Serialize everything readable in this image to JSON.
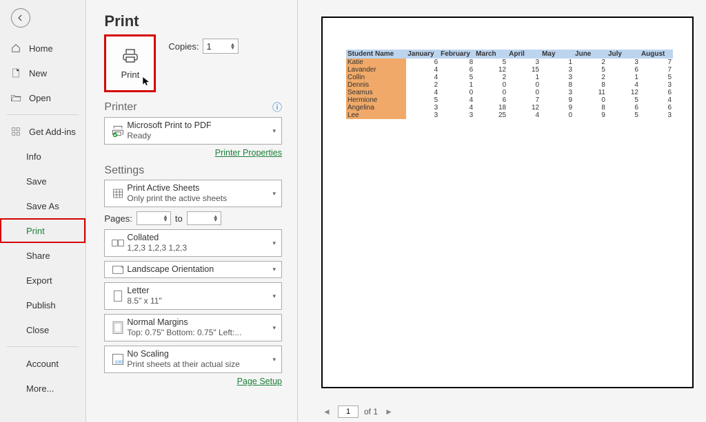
{
  "title": "Print",
  "sidebar": {
    "main": [
      "Home",
      "New",
      "Open"
    ],
    "addins": "Get Add-ins",
    "sub": [
      "Info",
      "Save",
      "Save As",
      "Print",
      "Share",
      "Export",
      "Publish",
      "Close"
    ],
    "bottom": [
      "Account",
      "More..."
    ],
    "active": "Print"
  },
  "print": {
    "btn_label": "Print",
    "copies_label": "Copies:",
    "copies_value": "1"
  },
  "printer": {
    "header": "Printer",
    "name": "Microsoft Print to PDF",
    "status": "Ready",
    "props_link": "Printer Properties"
  },
  "settings": {
    "header": "Settings",
    "active_sheets_t1": "Print Active Sheets",
    "active_sheets_t2": "Only print the active sheets",
    "pages_label": "Pages:",
    "pages_to": "to",
    "collated_t1": "Collated",
    "collated_t2": "1,2,3    1,2,3    1,2,3",
    "orientation": "Landscape Orientation",
    "paper_t1": "Letter",
    "paper_t2": "8.5\" x 11\"",
    "margins_t1": "Normal Margins",
    "margins_t2": "Top: 0.75\" Bottom: 0.75\" Left:...",
    "scaling_t1": "No Scaling",
    "scaling_t2": "Print sheets at their actual size",
    "setup_link": "Page Setup"
  },
  "pagenav": {
    "page": "1",
    "of_label": "of 1"
  },
  "chart_data": {
    "type": "table",
    "columns": [
      "Student Name",
      "January",
      "February",
      "March",
      "April",
      "May",
      "June",
      "July",
      "August"
    ],
    "rows": [
      [
        "Katie",
        6,
        8,
        5,
        3,
        1,
        2,
        3,
        7
      ],
      [
        "Lavander",
        4,
        6,
        12,
        15,
        3,
        5,
        6,
        7
      ],
      [
        "Collin",
        4,
        5,
        2,
        1,
        3,
        2,
        1,
        5
      ],
      [
        "Dennis",
        2,
        1,
        0,
        0,
        8,
        8,
        4,
        3
      ],
      [
        "Seamus",
        4,
        0,
        0,
        0,
        3,
        11,
        12,
        6
      ],
      [
        "Hermione",
        5,
        4,
        6,
        7,
        9,
        0,
        5,
        4
      ],
      [
        "Angelina",
        3,
        4,
        18,
        12,
        9,
        8,
        6,
        6
      ],
      [
        "Lee",
        3,
        3,
        25,
        4,
        0,
        9,
        5,
        3
      ]
    ]
  }
}
